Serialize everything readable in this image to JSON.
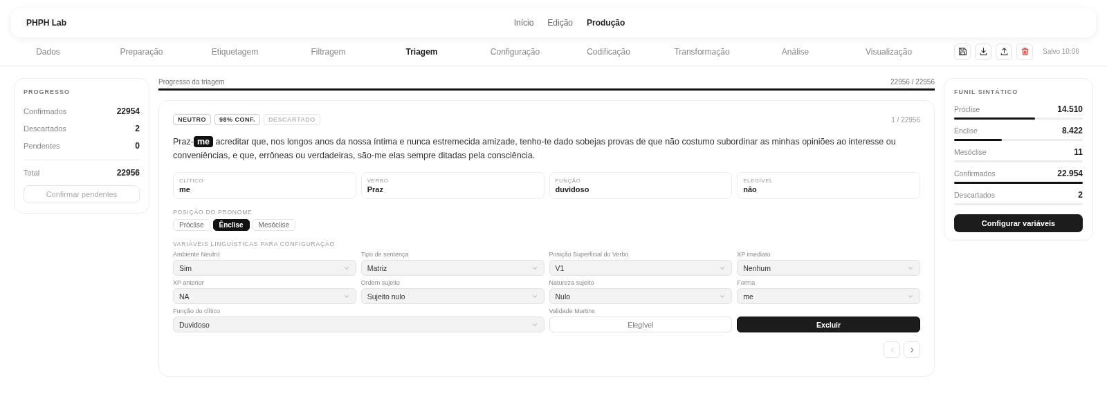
{
  "header": {
    "brand": "PHPH Lab",
    "nav": [
      {
        "label": "Início",
        "selected": false
      },
      {
        "label": "Edição",
        "selected": false
      },
      {
        "label": "Produção",
        "selected": true
      }
    ]
  },
  "steps": [
    {
      "label": "Dados",
      "selected": false
    },
    {
      "label": "Preparação",
      "selected": false
    },
    {
      "label": "Etiquetagem",
      "selected": false
    },
    {
      "label": "Filtragem",
      "selected": false
    },
    {
      "label": "Triagem",
      "selected": true
    },
    {
      "label": "Configuração",
      "selected": false
    },
    {
      "label": "Codificação",
      "selected": false
    },
    {
      "label": "Transformação",
      "selected": false
    },
    {
      "label": "Análise",
      "selected": false
    },
    {
      "label": "Visualização",
      "selected": false
    }
  ],
  "actions": [
    {
      "kind": "save"
    },
    {
      "kind": "download"
    },
    {
      "kind": "upload"
    },
    {
      "kind": "delete"
    }
  ],
  "saved": "Salvo 10:06",
  "progress_panel": {
    "title": "PROGRESSO",
    "rows": [
      {
        "label": "Confirmados",
        "value": "22954"
      },
      {
        "label": "Descartados",
        "value": "2"
      },
      {
        "label": "Pendentes",
        "value": "0"
      }
    ],
    "total": {
      "label": "Total",
      "value": "22956"
    },
    "button": {
      "label": "Confirmar pendentes",
      "disabled": true
    }
  },
  "triage_progress": {
    "label": "Progresso da triagem",
    "reading": "22956 / 22956",
    "level": 1
  },
  "item": {
    "badges": [
      {
        "label": "NEUTRO",
        "active": true
      },
      {
        "label": "98% CONF.",
        "active": true
      },
      {
        "label": "DESCARTADO",
        "active": false
      }
    ],
    "counter": "1 / 22956",
    "sentence": "Praz-**me** acreditar que, nos longos anos da nossa íntima e nunca estremecida amizade, tenho-te dado sobejas provas de que não costumo subordinar as minhas opiniões ao interesse ou conveniências, e que, errôneas ou verdadeiras, são-me elas sempre ditadas pela consciência.",
    "facts": [
      {
        "label": "CLÍTICO",
        "value": "me"
      },
      {
        "label": "VERBO",
        "value": "Praz"
      },
      {
        "label": "FUNÇÃO",
        "value": "duvidoso"
      },
      {
        "label": "ELEGÍVEL",
        "value": "não"
      }
    ],
    "position": {
      "title": "POSIÇÃO DO PRONOME",
      "options": [
        {
          "label": "Próclise",
          "selected": false
        },
        {
          "label": "Ênclise",
          "selected": true
        },
        {
          "label": "Mesóclise",
          "selected": false
        }
      ]
    },
    "variables": {
      "title": "VARIÁVEIS LINGUÍSTICAS PARA CONFIGURAÇÃO",
      "fields": [
        {
          "kind": "select",
          "label": "Ambiente Neutro",
          "value": "Sim"
        },
        {
          "kind": "select",
          "label": "Tipo de sentença",
          "value": "Matriz"
        },
        {
          "kind": "select",
          "label": "Posição Superficial do Verbo",
          "value": "V1"
        },
        {
          "kind": "select",
          "label": "XP imediato",
          "value": "Nenhum"
        },
        {
          "kind": "select",
          "label": "XP anterior",
          "value": "NA"
        },
        {
          "kind": "select",
          "label": "Ordem sujeito",
          "value": "Sujeito nulo"
        },
        {
          "kind": "select",
          "label": "Natureza sujeito",
          "value": "Nulo"
        },
        {
          "kind": "select",
          "label": "Forma",
          "value": "me"
        },
        {
          "kind": "wide-select",
          "label": "Função do clítico",
          "value": "Duvidoso"
        },
        {
          "kind": "choice",
          "label": "Validade Martins",
          "options": [
            {
              "label": "Elegível",
              "selected": false
            },
            {
              "label": "Excluir",
              "selected": true
            }
          ]
        }
      ]
    },
    "pager": {
      "previous": {
        "disabled": true
      },
      "next": {
        "disabled": false
      }
    }
  },
  "funnel": {
    "title": "FUNIL SINTÁTICO",
    "rows": [
      {
        "label": "Próclise",
        "value": "14.510",
        "level": 0.63
      },
      {
        "label": "Ênclise",
        "value": "8.422",
        "level": 0.37
      },
      {
        "label": "Mesóclise",
        "value": "11",
        "level": 0
      },
      {
        "label": "Confirmados",
        "value": "22.954",
        "level": 1
      },
      {
        "label": "Descartados",
        "value": "2",
        "level": 0
      }
    ],
    "button": "Configurar variáveis"
  }
}
